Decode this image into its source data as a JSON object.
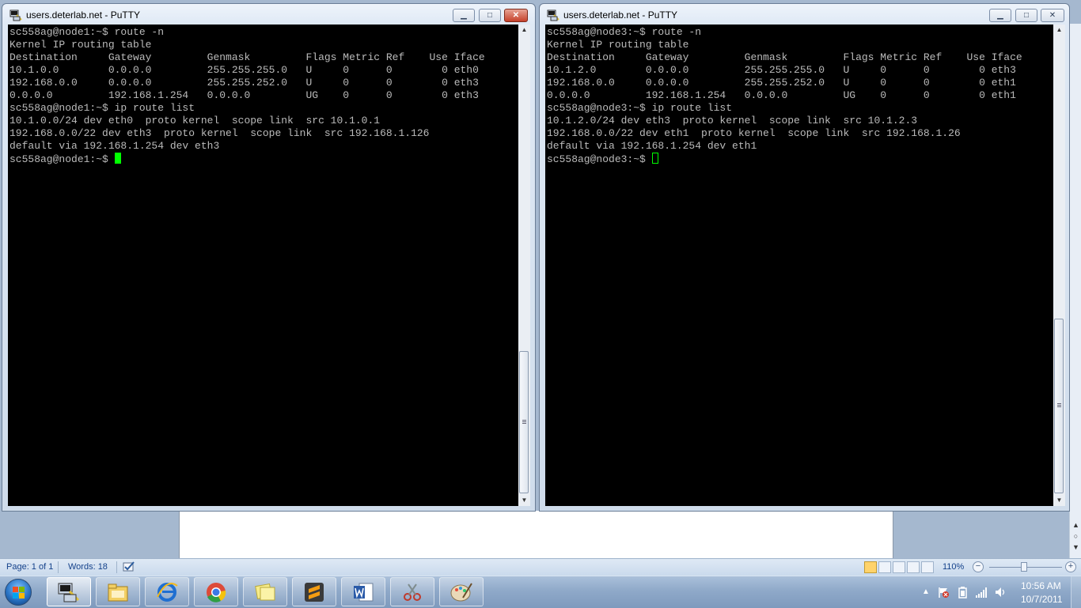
{
  "word": {
    "page_label": "Page: 1 of 1",
    "words_label": "Words: 18",
    "zoom": "110%",
    "zoom_minus": "−",
    "zoom_plus": "+"
  },
  "left_window": {
    "title": "users.deterlab.net - PuTTY",
    "min": "▁",
    "max": "□",
    "close": "✕",
    "lines": [
      "sc558ag@node1:~$ route -n",
      "Kernel IP routing table",
      "Destination     Gateway         Genmask         Flags Metric Ref    Use Iface",
      "10.1.0.0        0.0.0.0         255.255.255.0   U     0      0        0 eth0",
      "192.168.0.0     0.0.0.0         255.255.252.0   U     0      0        0 eth3",
      "0.0.0.0         192.168.1.254   0.0.0.0         UG    0      0        0 eth3",
      "sc558ag@node1:~$ ip route list",
      "10.1.0.0/24 dev eth0  proto kernel  scope link  src 10.1.0.1",
      "192.168.0.0/22 dev eth3  proto kernel  scope link  src 192.168.1.126",
      "default via 192.168.1.254 dev eth3",
      "sc558ag@node1:~$ "
    ]
  },
  "right_window": {
    "title": "users.deterlab.net - PuTTY",
    "min": "▁",
    "max": "□",
    "close": "✕",
    "lines": [
      "sc558ag@node3:~$ route -n",
      "Kernel IP routing table",
      "Destination     Gateway         Genmask         Flags Metric Ref    Use Iface",
      "10.1.2.0        0.0.0.0         255.255.255.0   U     0      0        0 eth3",
      "192.168.0.0     0.0.0.0         255.255.252.0   U     0      0        0 eth1",
      "0.0.0.0         192.168.1.254   0.0.0.0         UG    0      0        0 eth1",
      "sc558ag@node3:~$ ip route list",
      "10.1.2.0/24 dev eth3  proto kernel  scope link  src 10.1.2.3",
      "192.168.0.0/22 dev eth1  proto kernel  scope link  src 192.168.1.26",
      "default via 192.168.1.254 dev eth1",
      "sc558ag@node3:~$ "
    ]
  },
  "taskbar": {
    "apps": [
      "putty-icon",
      "explorer-icon",
      "internet-explorer-icon",
      "chrome-icon",
      "sticky-notes-icon",
      "sublime-icon",
      "word-icon",
      "snipping-tool-icon",
      "paint-icon"
    ],
    "time": "10:56 AM",
    "date": "10/7/2011"
  },
  "colors": {
    "terminal_bg": "#000000",
    "terminal_fg": "#bbbbbb",
    "cursor": "#00ff00",
    "close_button": "#c6412a"
  }
}
